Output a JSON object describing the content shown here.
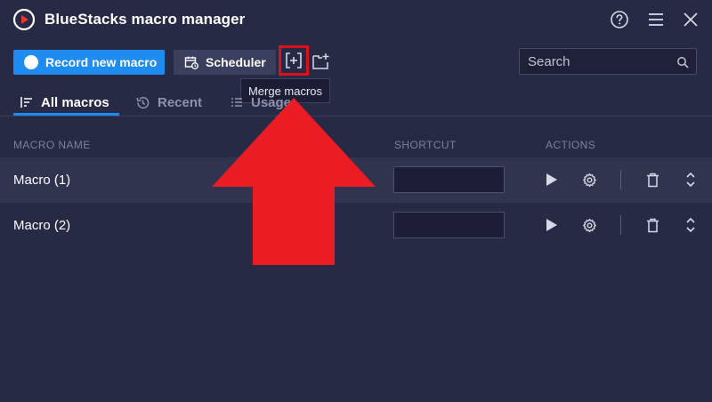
{
  "app": {
    "title": "BlueStacks macro manager"
  },
  "toolbar": {
    "record_label": "Record new macro",
    "scheduler_label": "Scheduler",
    "merge_tooltip": "Merge macros"
  },
  "search": {
    "placeholder": "Search"
  },
  "tabs": [
    {
      "label": "All macros",
      "active": true
    },
    {
      "label": "Recent",
      "active": false
    },
    {
      "label": "Usage",
      "active": false
    }
  ],
  "table": {
    "headers": {
      "name": "MACRO NAME",
      "shortcut": "SHORTCUT",
      "actions": "ACTIONS"
    },
    "rows": [
      {
        "name": "Macro (1)",
        "shortcut": ""
      },
      {
        "name": "Macro (2)",
        "shortcut": ""
      }
    ]
  },
  "colors": {
    "accent": "#1f8cf2",
    "highlight": "#e0101b",
    "background": "#262a45"
  }
}
